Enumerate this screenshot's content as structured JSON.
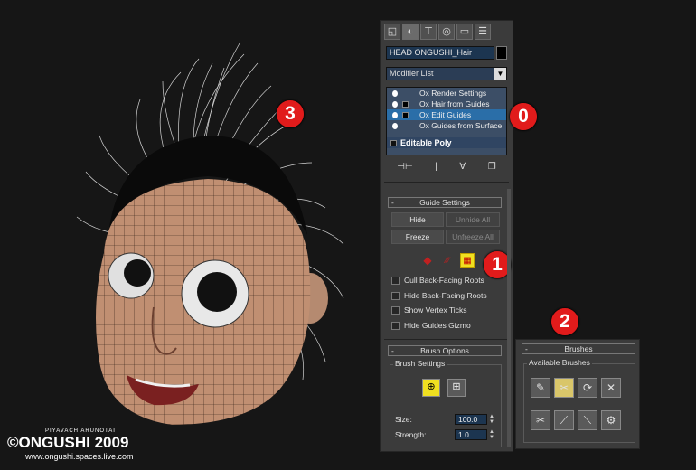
{
  "watermark": {
    "author": "PIYAVACH ARUNOTAI",
    "brand": "©ONGUSHI 2009",
    "url": "www.ongushi.spaces.live.com"
  },
  "callouts": {
    "c13": [
      "1",
      "3"
    ],
    "c10": [
      "1",
      "0"
    ],
    "c11": [
      "1",
      "1"
    ],
    "c12": [
      "1",
      "2"
    ]
  },
  "toolbar": {
    "icons": [
      "create-icon",
      "modify-icon",
      "hierarchy-icon",
      "motion-icon",
      "display-icon",
      "utilities-icon"
    ]
  },
  "object": {
    "name": "HEAD ONGUSHI_Hair",
    "color": "#000000"
  },
  "modifier_list": {
    "label": "Modifier List",
    "arrow": "▼"
  },
  "stack": {
    "items": [
      {
        "label": "Ox Render Settings",
        "selected": false
      },
      {
        "label": "Ox Hair from Guides",
        "selected": false
      },
      {
        "label": "Ox Edit Guides",
        "selected": true
      },
      {
        "label": "Ox Guides from Surface",
        "selected": false
      }
    ],
    "base": "Editable Poly"
  },
  "stack_tools": {
    "items": [
      "⊣⊢",
      "|",
      "∀",
      "❐"
    ]
  },
  "guide_settings": {
    "title": "Guide Settings",
    "hide": "Hide",
    "unhide_all": "Unhide All",
    "freeze": "Freeze",
    "unfreeze_all": "Unfreeze All",
    "icons": [
      "◆",
      "⁄⁄⁄",
      "▦"
    ],
    "checks": [
      "Cull Back-Facing Roots",
      "Hide Back-Facing Roots",
      "Show Vertex Ticks",
      "Hide Guides Gizmo"
    ]
  },
  "brush_options": {
    "title": "Brush Options",
    "group": "Brush Settings",
    "size_label": "Size:",
    "size_value": "100.0",
    "strength_label": "Strength:",
    "strength_value": "1.0"
  },
  "brushes": {
    "title": "Brushes",
    "group": "Available Brushes"
  },
  "minus": "-"
}
